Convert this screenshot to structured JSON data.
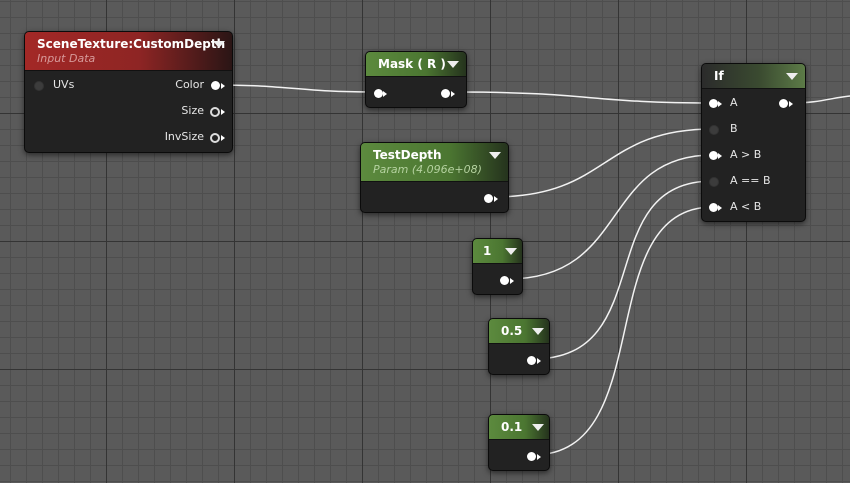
{
  "scene_texture": {
    "title": "SceneTexture:CustomDepth",
    "subtitle": "Input Data",
    "inputs": [
      "UVs"
    ],
    "outputs": [
      "Color",
      "Size",
      "InvSize"
    ]
  },
  "mask": {
    "title": "Mask ( R )"
  },
  "test_depth": {
    "title": "TestDepth",
    "subtitle": "Param (4.096e+08)"
  },
  "if_node": {
    "title": "If",
    "inputs": [
      "A",
      "B",
      "A > B",
      "A == B",
      "A < B"
    ]
  },
  "constants": [
    {
      "value": "1"
    },
    {
      "value": "0.5"
    },
    {
      "value": "0.1"
    }
  ],
  "colors": {
    "grid_bg": "#5a5a5a",
    "texture_header": "#a32826",
    "param_header": "#5c8a3e",
    "wire": "#ffffff"
  }
}
